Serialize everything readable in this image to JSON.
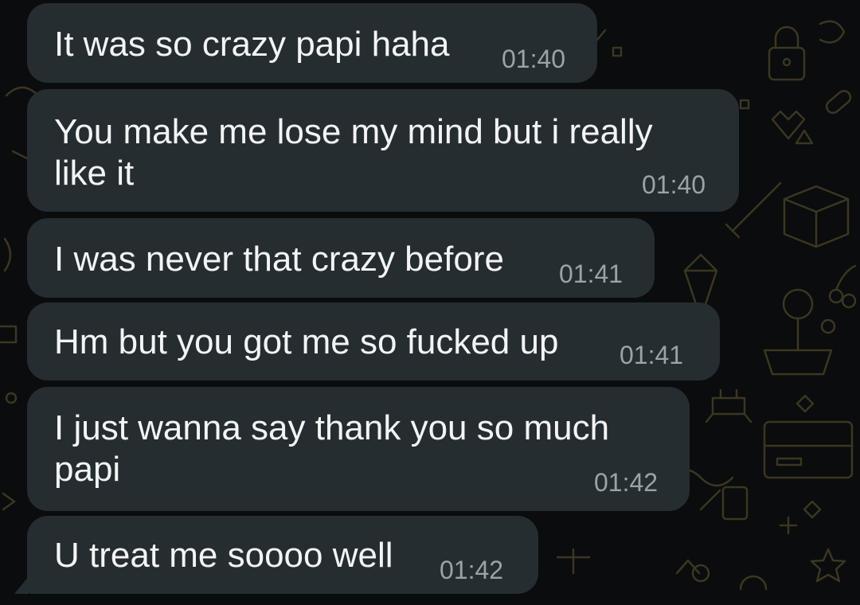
{
  "messages": [
    {
      "text": "It was so crazy papi haha",
      "time": "01:40"
    },
    {
      "text": "You make me lose my mind but i really\nlike it",
      "time": "01:40"
    },
    {
      "text": "I was never that crazy before",
      "time": "01:41"
    },
    {
      "text": "Hm but you got me so fucked up",
      "time": "01:41"
    },
    {
      "text": "I just wanna say thank you so much\npapi",
      "time": "01:42"
    },
    {
      "text": "U treat me soooo well",
      "time": "01:42"
    }
  ],
  "colors": {
    "background": "#0a0c0d",
    "bubble": "#262d31",
    "text": "#f2f4f5",
    "timestamp": "#9aa3a7",
    "wallpaper_doodle": "#3a3722"
  }
}
